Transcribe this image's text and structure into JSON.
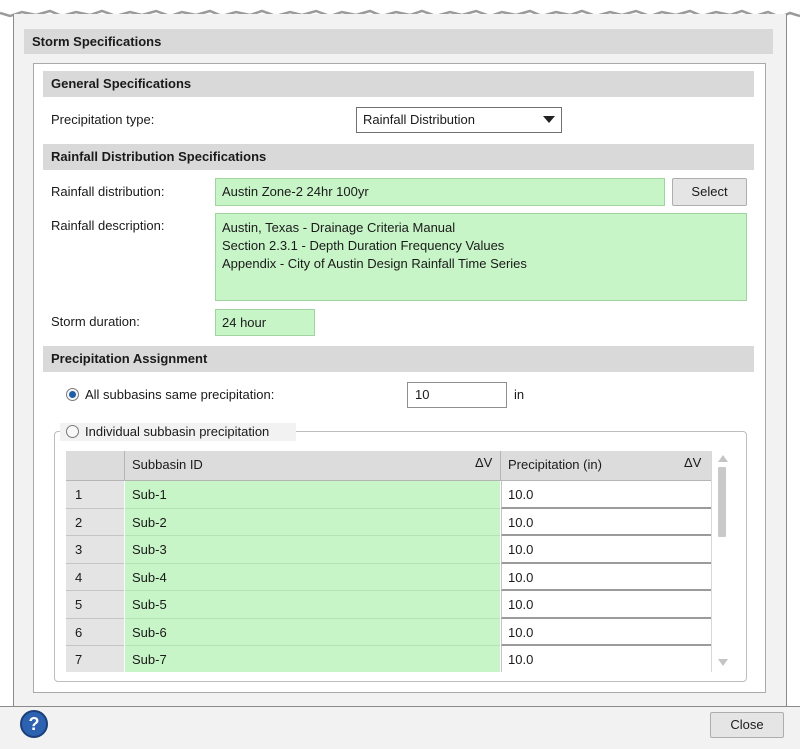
{
  "dialog": {
    "section_title": "Storm Specifications",
    "colors": {
      "green_field": "#c8f5c8",
      "header_bg": "#d9d9d9",
      "radio_selected": "#1f5fa8",
      "help_icon": "#2d62b0"
    }
  },
  "general": {
    "header": "General Specifications",
    "precip_type_label": "Precipitation type:",
    "precip_type_value": "Rainfall Distribution"
  },
  "rainfall": {
    "header": "Rainfall Distribution Specifications",
    "distribution_label": "Rainfall distribution:",
    "distribution_value": "Austin Zone-2 24hr 100yr",
    "select_label": "Select",
    "description_label": "Rainfall description:",
    "description_lines": [
      "Austin, Texas - Drainage Criteria Manual",
      "Section 2.3.1 - Depth Duration Frequency Values",
      "Appendix - City of Austin Design Rainfall Time Series"
    ],
    "duration_label": "Storm duration:",
    "duration_value": "24 hour"
  },
  "assignment": {
    "header": "Precipitation Assignment",
    "all_same_label": "All subbasins same precipitation:",
    "all_same_value": "10",
    "unit": "in",
    "individual_label": "Individual subbasin precipitation",
    "all_same_selected": true
  },
  "grid": {
    "col_subbasin": "Subbasin ID",
    "col_precip": "Precipitation (in)",
    "sort_glyph": "ΔV",
    "rows": [
      {
        "num": "1",
        "id": "Sub-1",
        "precip": "10.0"
      },
      {
        "num": "2",
        "id": "Sub-2",
        "precip": "10.0"
      },
      {
        "num": "3",
        "id": "Sub-3",
        "precip": "10.0"
      },
      {
        "num": "4",
        "id": "Sub-4",
        "precip": "10.0"
      },
      {
        "num": "5",
        "id": "Sub-5",
        "precip": "10.0"
      },
      {
        "num": "6",
        "id": "Sub-6",
        "precip": "10.0"
      },
      {
        "num": "7",
        "id": "Sub-7",
        "precip": "10.0"
      }
    ]
  },
  "footer": {
    "help_glyph": "?",
    "close_label": "Close"
  }
}
